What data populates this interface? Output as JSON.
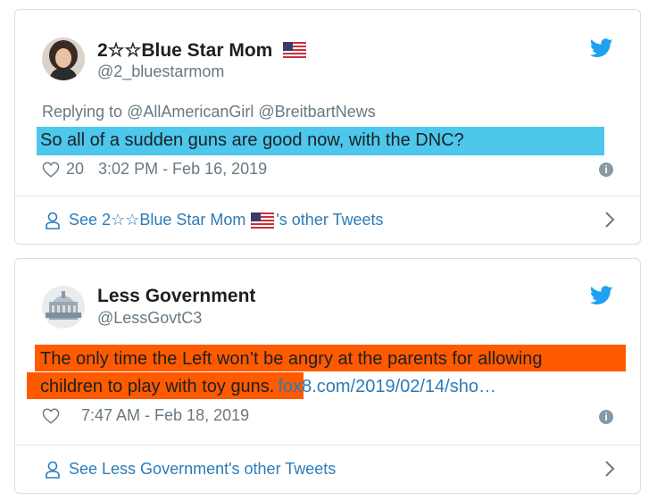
{
  "tweets": [
    {
      "display_name": "2☆☆Blue Star Mom",
      "handle": "@2_bluestarmom",
      "replying_prefix": "Replying to",
      "replying_to": [
        "@AllAmericanGirl",
        "@BreitbartNews"
      ],
      "text": "So all of a sudden guns are good now, with the DNC?",
      "likes": "20",
      "timestamp": "3:02 PM - Feb 16, 2019",
      "other_tweets_pre": "See 2☆☆Blue Star Mom",
      "other_tweets_post": "'s other Tweets",
      "highlight_color": "#4dc8ec"
    },
    {
      "display_name": "Less Government",
      "handle": "@LessGovtC3",
      "text_line1": "The only time the Left won’t be angry at the parents for allowing",
      "text_line2": "children to play with toy guns.",
      "link": "fox8.com/2019/02/14/sho…",
      "timestamp": "7:47 AM - Feb 18, 2019",
      "other_tweets": "See Less Government's other Tweets",
      "highlight_color": "#ff5a00"
    }
  ],
  "icons": {
    "bird": "twitter-bird-icon",
    "heart": "heart-icon",
    "info": "info-icon",
    "person": "person-icon",
    "chevron": "chevron-right-icon",
    "flag": "us-flag-icon"
  },
  "colors": {
    "accent": "#1da1f2",
    "link": "#2b7bb9",
    "muted": "#697882"
  }
}
